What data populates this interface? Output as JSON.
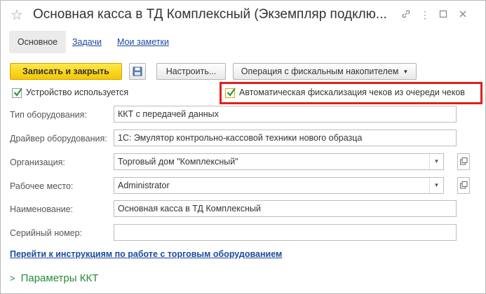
{
  "window": {
    "title": "Основная касса в ТД Комплексный (Экземпляр подклю..."
  },
  "tabs": [
    {
      "label": "Основное"
    },
    {
      "label": "Задачи"
    },
    {
      "label": "Мои заметки"
    }
  ],
  "toolbar": {
    "write_close_label": "Записать и закрыть",
    "setup_label": "Настроить...",
    "fiscal_label": "Операция с фискальным накопителем"
  },
  "checkboxes": {
    "device_used": {
      "label": "Устройство используется",
      "checked": true
    },
    "auto_fiscal": {
      "label": "Автоматическая фискализация чеков из очереди чеков",
      "checked": true
    }
  },
  "form": {
    "equipment_type": {
      "label": "Тип оборудования:",
      "value": "ККТ с передачей данных"
    },
    "driver": {
      "label": "Драйвер оборудования:",
      "value": "1С: Эмулятор контрольно-кассовой техники нового образца"
    },
    "organization": {
      "label": "Организация:",
      "value": "Торговый дом \"Комплексный\""
    },
    "workplace": {
      "label": "Рабочее место:",
      "value": "Administrator"
    },
    "name": {
      "label": "Наименование:",
      "value": "Основная касса в ТД Комплексный"
    },
    "serial": {
      "label": "Серийный номер:",
      "value": ""
    }
  },
  "instructions_link": "Перейти к инструкциям по работе с торговым оборудованием",
  "group_kkt": "Параметры ККТ",
  "colors": {
    "accent_link": "#1b4b9c",
    "primary_button": "#f5c800",
    "highlight": "#e0201b",
    "group": "#2a8a3a"
  }
}
